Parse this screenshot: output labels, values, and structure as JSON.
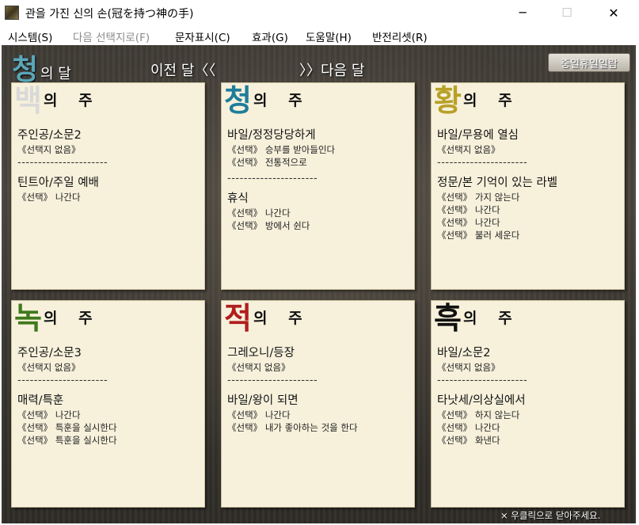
{
  "window": {
    "title": "관을 가진 신의 손(冠を持つ神の手)",
    "minimize_glyph": "─",
    "maximize_glyph": "☐",
    "close_glyph": "✕"
  },
  "menu": [
    {
      "label": "시스템(S)",
      "enabled": true
    },
    {
      "label": "다음 선택지로(F)",
      "enabled": false
    },
    {
      "label": "문자표시(C)",
      "enabled": true
    },
    {
      "label": "효과(G)",
      "enabled": true
    },
    {
      "label": "도움말(H)",
      "enabled": true
    },
    {
      "label": "반전리셋(R)",
      "enabled": true
    }
  ],
  "header": {
    "month_big": "청",
    "month_small": "의 달",
    "prev_month": "이전 달〈〈",
    "next_month": "〉〉다음 달",
    "holiday_list": "중일휴일일람"
  },
  "weeks": [
    {
      "glyph": "백",
      "glyph_color": "#d9d9d9",
      "suffix": "의 주",
      "events": [
        {
          "title": "주인공/소문2",
          "choices": [
            "《선택지 없음》"
          ]
        },
        {
          "title": "틴트아/주일 예배",
          "choices": [
            "《선택》 나간다"
          ]
        }
      ]
    },
    {
      "glyph": "청",
      "glyph_color": "#1f7d9a",
      "suffix": "의 주",
      "events": [
        {
          "title": "바일/정정당당하게",
          "choices": [
            "《선택》 승부를 받아들인다",
            "《선택》 전통적으로"
          ]
        },
        {
          "title": "휴식",
          "choices": [
            "《선택》 나간다",
            "《선택》 방에서 쉰다"
          ]
        }
      ]
    },
    {
      "glyph": "황",
      "glyph_color": "#b8a128",
      "suffix": "의 주",
      "events": [
        {
          "title": "바일/무용에 열심",
          "choices": [
            "《선택지 없음》"
          ]
        },
        {
          "title": "정문/본 기억이 있는 라벨",
          "choices": [
            "《선택》 가지 않는다",
            "《선택》 나간다",
            "《선택》 나간다",
            "《선택》 불러 세운다"
          ]
        }
      ]
    },
    {
      "glyph": "녹",
      "glyph_color": "#3f7a1c",
      "suffix": "의 주",
      "events": [
        {
          "title": "주인공/소문3",
          "choices": [
            "《선택지 없음》"
          ]
        },
        {
          "title": "매력/특훈",
          "choices": [
            "《선택》 나간다",
            "《선택》 특훈을 실시한다",
            "《선택》 특훈을 실시한다"
          ]
        }
      ]
    },
    {
      "glyph": "적",
      "glyph_color": "#b01e1e",
      "suffix": "의 주",
      "events": [
        {
          "title": "그레오니/등장",
          "choices": [
            "《선택지 없음》"
          ]
        },
        {
          "title": "바일/왕이 되면",
          "choices": [
            "《선택》 나간다",
            "《선택》 내가 좋아하는 것을 한다"
          ]
        }
      ]
    },
    {
      "glyph": "흑",
      "glyph_color": "#111111",
      "suffix": "의 주",
      "events": [
        {
          "title": "바일/소문2",
          "choices": [
            "《선택지 없음》"
          ]
        },
        {
          "title": "타낫세/의상실에서",
          "choices": [
            "《선택》 하지 않는다",
            "《선택》 나간다",
            "《선택》 화낸다"
          ]
        }
      ]
    }
  ],
  "separator_text": "----------------------",
  "footer_hint": "× 우클릭으로 닫아주세요."
}
